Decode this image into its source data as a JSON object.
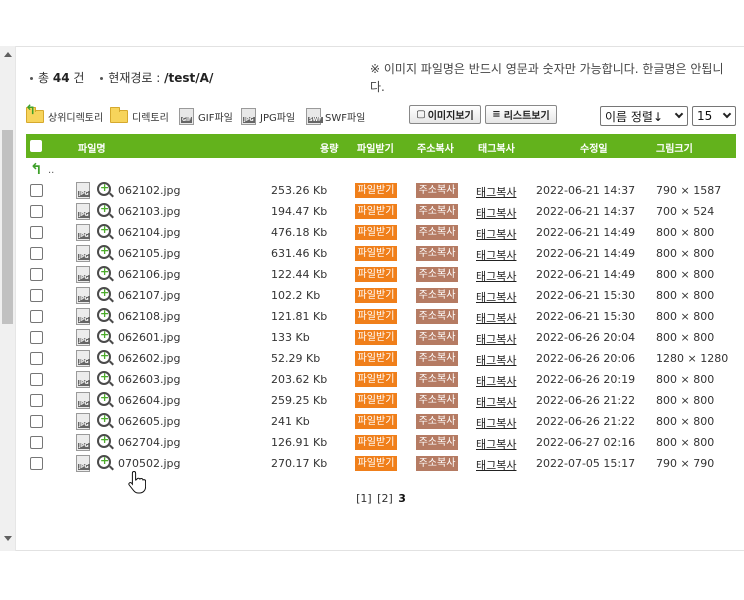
{
  "info": {
    "total_label": "총",
    "total_count": "44",
    "total_unit": "건",
    "path_label": "현재경로 :",
    "path_value": "/test/A/",
    "notice": "※ 이미지 파일명은 반드시 영문과 숫자만 가능합니다. 한글명은 안됩니다."
  },
  "toolbar": {
    "parent_dir": "상위디렉토리",
    "directory": "디렉토리",
    "gif": "GIF파일",
    "jpg": "JPG파일",
    "swf": "SWF파일",
    "image_view": "이미지보기",
    "list_view": "리스트보기",
    "sort_selected": "이름 정렬↓",
    "per_page_selected": "15"
  },
  "columns": {
    "name": "파일명",
    "size": "용량",
    "download": "파일받기",
    "copy_address": "주소복사",
    "copy_tag": "태그복사",
    "modified": "수정일",
    "dimensions": "그림크기"
  },
  "parent_row_label": "..",
  "row_labels": {
    "download": "파일받기",
    "copy_address": "주소복사",
    "copy_tag": "태그복사",
    "jpg_badge": "JPG"
  },
  "files": [
    {
      "name": "062102.jpg",
      "size": "253.26 Kb",
      "date": "2022-06-21 14:37",
      "dim": "790 × 1587"
    },
    {
      "name": "062103.jpg",
      "size": "194.47 Kb",
      "date": "2022-06-21 14:37",
      "dim": "700 × 524"
    },
    {
      "name": "062104.jpg",
      "size": "476.18 Kb",
      "date": "2022-06-21 14:49",
      "dim": "800 × 800"
    },
    {
      "name": "062105.jpg",
      "size": "631.46 Kb",
      "date": "2022-06-21 14:49",
      "dim": "800 × 800"
    },
    {
      "name": "062106.jpg",
      "size": "122.44 Kb",
      "date": "2022-06-21 14:49",
      "dim": "800 × 800"
    },
    {
      "name": "062107.jpg",
      "size": "102.2 Kb",
      "date": "2022-06-21 15:30",
      "dim": "800 × 800"
    },
    {
      "name": "062108.jpg",
      "size": "121.81 Kb",
      "date": "2022-06-21 15:30",
      "dim": "800 × 800"
    },
    {
      "name": "062601.jpg",
      "size": "133 Kb",
      "date": "2022-06-26 20:04",
      "dim": "800 × 800"
    },
    {
      "name": "062602.jpg",
      "size": "52.29 Kb",
      "date": "2022-06-26 20:06",
      "dim": "1280 × 1280"
    },
    {
      "name": "062603.jpg",
      "size": "203.62 Kb",
      "date": "2022-06-26 20:19",
      "dim": "800 × 800"
    },
    {
      "name": "062604.jpg",
      "size": "259.25 Kb",
      "date": "2022-06-26 21:22",
      "dim": "800 × 800"
    },
    {
      "name": "062605.jpg",
      "size": "241 Kb",
      "date": "2022-06-26 21:22",
      "dim": "800 × 800"
    },
    {
      "name": "062704.jpg",
      "size": "126.91 Kb",
      "date": "2022-06-27 02:16",
      "dim": "800 × 800"
    },
    {
      "name": "070502.jpg",
      "size": "270.17 Kb",
      "date": "2022-07-05 15:17",
      "dim": "790 × 790"
    }
  ],
  "pager": {
    "page1": "[1]",
    "page2": "[2]",
    "current": "3"
  },
  "icons": {
    "parent_dir": "folder-up-icon",
    "directory": "folder-icon",
    "file_type": "jpg-file-icon",
    "preview": "zoom-in-icon",
    "cursor": "hand-pointer-icon"
  },
  "colors": {
    "header_bg": "#63b21c",
    "download_bg": "#f07f1a",
    "copy_bg": "#b57b63"
  }
}
